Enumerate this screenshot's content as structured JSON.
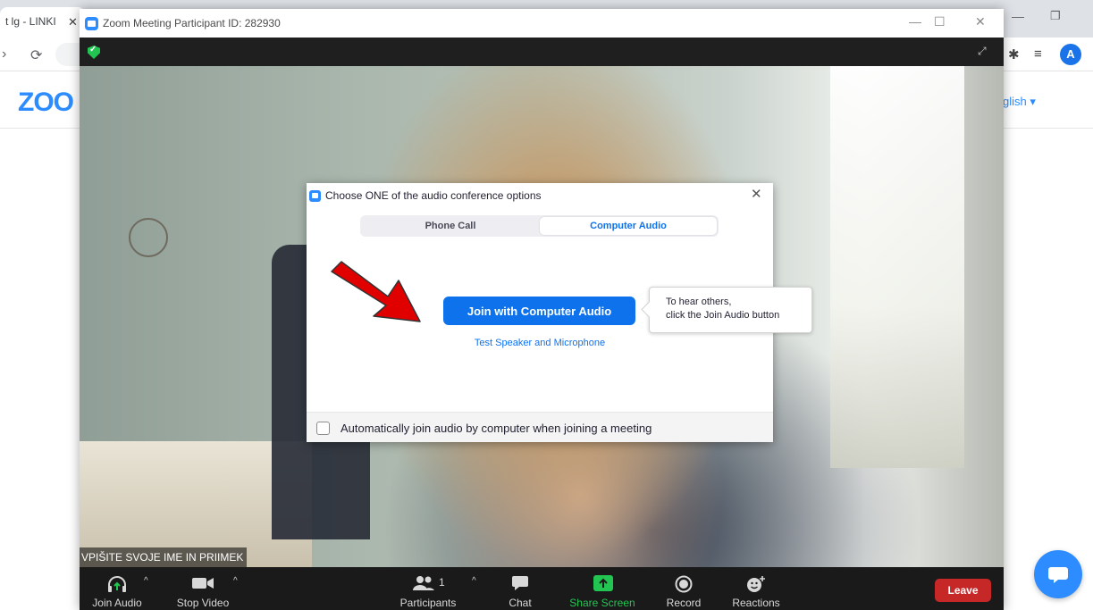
{
  "browser": {
    "tab_title": "t lg - LINKI",
    "tab_close": "✕",
    "win_min": "—",
    "win_restore": "❐",
    "profile_initial": "A",
    "site_logo": "ZOO",
    "site_language": "glish ▾"
  },
  "zoom_window": {
    "title": "Zoom Meeting Participant ID: 282930",
    "controls": {
      "minimize": "—",
      "maximize": "☐",
      "close": "✕"
    },
    "fullscreen_icon": "⤢",
    "participant_name": "VPIŠITE SVOJE IME IN PRIIMEK"
  },
  "dialog": {
    "title": "Choose ONE of the audio conference options",
    "close": "✕",
    "tabs": [
      {
        "label": "Phone Call",
        "selected": false
      },
      {
        "label": "Computer Audio",
        "selected": true
      }
    ],
    "join_button": "Join with Computer Audio",
    "test_link": "Test Speaker and Microphone",
    "tooltip_line1": "To hear others,",
    "tooltip_line2": "click the Join Audio button",
    "auto_join_label": "Automatically join audio by computer when joining a meeting",
    "auto_join_checked": false
  },
  "toolbar": {
    "join_audio": "Join Audio",
    "stop_video": "Stop Video",
    "participants": "Participants",
    "participants_count": "1",
    "chat": "Chat",
    "share_screen": "Share Screen",
    "record": "Record",
    "reactions": "Reactions",
    "leave": "Leave",
    "caret": "^"
  },
  "colors": {
    "zoom_blue": "#0e72ed",
    "share_green": "#23c552",
    "leave_red": "#c62828",
    "annotation_arrow": "#e00000"
  }
}
